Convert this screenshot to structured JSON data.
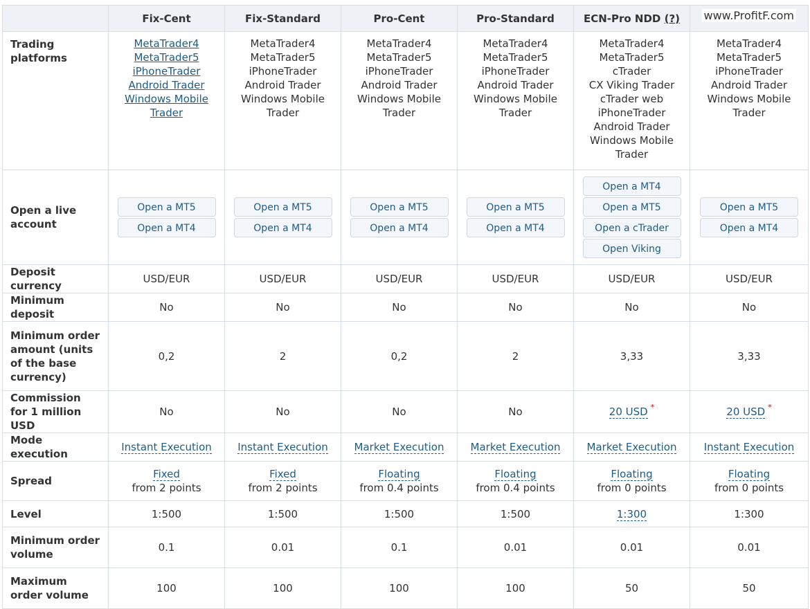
{
  "watermark": "www.ProfitF.com",
  "headers": [
    "",
    "Fix-Cent",
    "Fix-Standard",
    "Pro-Cent",
    "Pro-Standard",
    "ECN-Pro NDD",
    "(?)"
  ],
  "labels": {
    "platforms": "Trading platforms",
    "open_live": "Open a live account",
    "deposit_currency": "Deposit currency",
    "min_deposit": "Minimum deposit",
    "min_order_amount": "Minimum order amount (units of the base currency)",
    "commission": "Commission for 1 million USD",
    "mode": "Mode execution",
    "spread": "Spread",
    "level": "Level",
    "min_volume": "Minimum order volume",
    "max_volume": "Maximum order volume"
  },
  "platforms": [
    [
      "MetaTrader4",
      "MetaTrader5",
      "iPhoneTrader",
      "Android Trader",
      "Windows Mobile",
      "Trader"
    ],
    [
      "MetaTrader4",
      "MetaTrader5",
      "iPhoneTrader",
      "Android Trader",
      "Windows Mobile",
      "Trader"
    ],
    [
      "MetaTrader4",
      "MetaTrader5",
      "iPhoneTrader",
      "Android Trader",
      "Windows Mobile",
      "Trader"
    ],
    [
      "MetaTrader4",
      "MetaTrader5",
      "iPhoneTrader",
      "Android Trader",
      "Windows Mobile",
      "Trader"
    ],
    [
      "MetaTrader4",
      "MetaTrader5",
      "cTrader",
      "CX Viking Trader",
      "cTrader web",
      "iPhoneTrader",
      "Android Trader",
      "Windows Mobile",
      "Trader"
    ],
    [
      "MetaTrader4",
      "MetaTrader5",
      "iPhoneTrader",
      "Android Trader",
      "Windows Mobile",
      "Trader"
    ]
  ],
  "open_buttons": [
    [
      "Open a MT5",
      "Open a MT4"
    ],
    [
      "Open a MT5",
      "Open a MT4"
    ],
    [
      "Open a MT5",
      "Open a MT4"
    ],
    [
      "Open a MT5",
      "Open a MT4"
    ],
    [
      "Open a MT4",
      "Open a MT5",
      "Open a cTrader",
      "Open Viking"
    ],
    [
      "Open a MT5",
      "Open a MT4"
    ]
  ],
  "deposit_currency": [
    "USD/EUR",
    "USD/EUR",
    "USD/EUR",
    "USD/EUR",
    "USD/EUR",
    "USD/EUR"
  ],
  "min_deposit": [
    "No",
    "No",
    "No",
    "No",
    "No",
    "No"
  ],
  "min_order_amount": [
    "0,2",
    "2",
    "0,2",
    "2",
    "3,33",
    "3,33"
  ],
  "commission": [
    "No",
    "No",
    "No",
    "No",
    "20 USD",
    "20 USD"
  ],
  "commission_star": "*",
  "mode": [
    "Instant Execution",
    "Instant Execution",
    "Market Execution",
    "Market Execution",
    "Market Execution",
    "Instant Execution"
  ],
  "spread_type": [
    "Fixed",
    "Fixed",
    "Floating",
    "Floating",
    "Floating",
    "Floating"
  ],
  "spread_from": [
    "from 2 points",
    "from 2 points",
    "from 0.4 points",
    "from 0.4 points",
    "from 0 points",
    "from 0 points"
  ],
  "level": [
    "1:500",
    "1:500",
    "1:500",
    "1:500",
    "1:300",
    "1:300"
  ],
  "min_volume": [
    "0.1",
    "0.01",
    "0.1",
    "0.01",
    "0.01",
    "0.01"
  ],
  "max_volume": [
    "100",
    "100",
    "100",
    "100",
    "50",
    "50"
  ]
}
